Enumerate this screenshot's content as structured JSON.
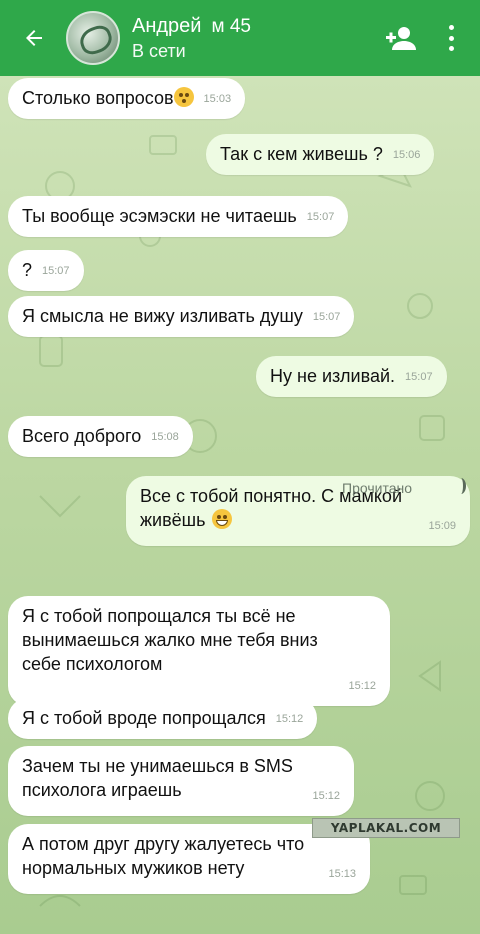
{
  "header": {
    "name": "Андрей",
    "subtitle": "м 45",
    "status": "В сети",
    "icons": {
      "back": "back-arrow-icon",
      "add_user": "add-contact-icon",
      "menu": "more-vert-icon"
    },
    "color": "#2fa84a"
  },
  "messages": [
    {
      "side": "in",
      "text": "Столько вопросов",
      "emoji": "flushed-face-icon",
      "time": "15:03"
    },
    {
      "side": "out",
      "text": "Так с кем живешь ?",
      "time": "15:06"
    },
    {
      "side": "in",
      "text": "Ты вообще эсэмэски не читаешь",
      "time": "15:07"
    },
    {
      "side": "in",
      "text": "?",
      "time": "15:07"
    },
    {
      "side": "in",
      "text": "Я смысла не вижу изливать душу",
      "time": "15:07"
    },
    {
      "side": "out",
      "text": "Ну не изливай.",
      "time": "15:07"
    },
    {
      "side": "in",
      "text": "Всего доброго",
      "time": "15:08"
    },
    {
      "side": "out",
      "text": "Все с тобой понятно. С мамкой\nживёшь",
      "emoji": "grinning-face-icon",
      "time": "15:09"
    },
    {
      "side": "in",
      "text": "Я с тобой попрощался ты всё не\nвынимаешься жалко мне тебя вниз\nсебе психологом",
      "time": "15:12"
    },
    {
      "side": "in",
      "text": "Я с тобой вроде попрощался",
      "time": "15:12"
    },
    {
      "side": "in",
      "text": "Зачем ты не унимаешься в SMS\nпсихолога играешь",
      "time": "15:12"
    },
    {
      "side": "in",
      "text": "А потом друг другу жалуетесь что\nнормальных мужиков нету",
      "time": "15:13"
    }
  ],
  "read_receipt": "Прочитано",
  "watermark": "YAPLAKAL.COM"
}
